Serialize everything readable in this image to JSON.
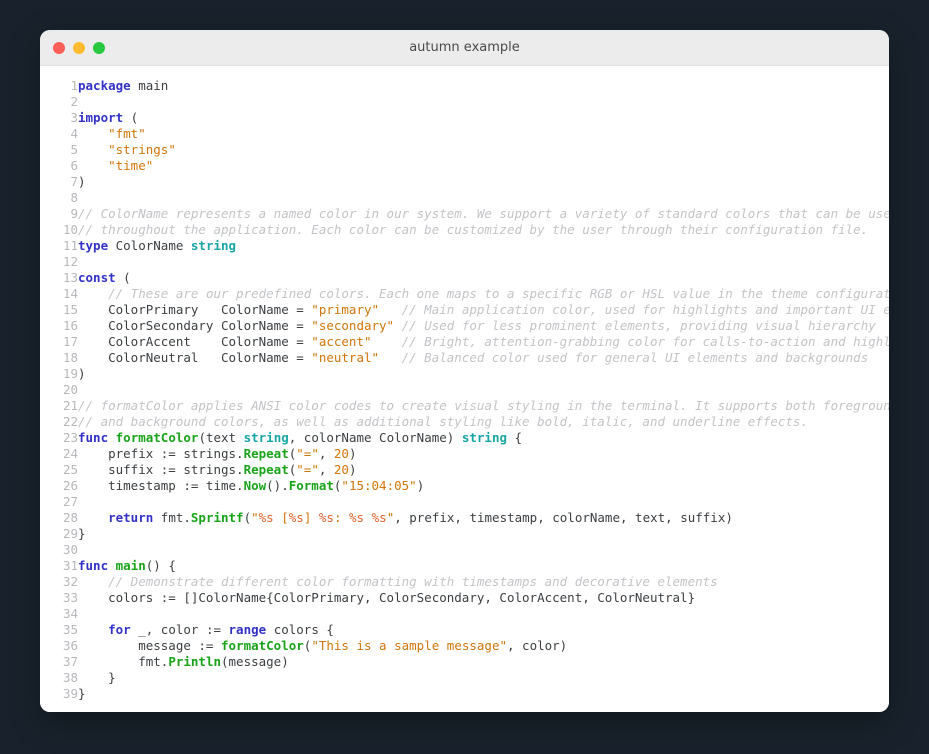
{
  "window": {
    "title": "autumn example",
    "traffic_lights": [
      {
        "name": "close-button",
        "color": "#ff5f57"
      },
      {
        "name": "minimize-button",
        "color": "#febc2e"
      },
      {
        "name": "maximize-button",
        "color": "#28c840"
      }
    ]
  },
  "theme": {
    "page_background": "#19222c",
    "window_background": "#ffffff",
    "titlebar_background": "#ececec",
    "keyword": "#3232c8",
    "type": "#1aa6a6",
    "string": "#d2760b",
    "format_verb": "#e2622b",
    "number": "#d2760b",
    "function": "#19a319",
    "comment": "#c2c4c7",
    "plain": "#3c4043",
    "line_number": "#b6b8bb"
  },
  "editor": {
    "language": "go",
    "first_line": 1,
    "last_line": 39,
    "lines": [
      {
        "n": 1,
        "tokens": [
          {
            "t": "kw",
            "v": "package"
          },
          {
            "t": "pl",
            "v": " main"
          }
        ]
      },
      {
        "n": 2,
        "tokens": []
      },
      {
        "n": 3,
        "tokens": [
          {
            "t": "kw",
            "v": "import"
          },
          {
            "t": "pl",
            "v": " ("
          }
        ]
      },
      {
        "n": 4,
        "tokens": [
          {
            "t": "pl",
            "v": "    "
          },
          {
            "t": "str",
            "v": "\"fmt\""
          }
        ]
      },
      {
        "n": 5,
        "tokens": [
          {
            "t": "pl",
            "v": "    "
          },
          {
            "t": "str",
            "v": "\"strings\""
          }
        ]
      },
      {
        "n": 6,
        "tokens": [
          {
            "t": "pl",
            "v": "    "
          },
          {
            "t": "str",
            "v": "\"time\""
          }
        ]
      },
      {
        "n": 7,
        "tokens": [
          {
            "t": "pl",
            "v": ")"
          }
        ]
      },
      {
        "n": 8,
        "tokens": []
      },
      {
        "n": 9,
        "tokens": [
          {
            "t": "cm",
            "v": "// ColorName represents a named color in our system. We support a variety of standard colors that can be used"
          }
        ]
      },
      {
        "n": 10,
        "tokens": [
          {
            "t": "cm",
            "v": "// throughout the application. Each color can be customized by the user through their configuration file."
          }
        ]
      },
      {
        "n": 11,
        "tokens": [
          {
            "t": "kw",
            "v": "type"
          },
          {
            "t": "pl",
            "v": " ColorName "
          },
          {
            "t": "typ",
            "v": "string"
          }
        ]
      },
      {
        "n": 12,
        "tokens": []
      },
      {
        "n": 13,
        "tokens": [
          {
            "t": "kw",
            "v": "const"
          },
          {
            "t": "pl",
            "v": " ("
          }
        ]
      },
      {
        "n": 14,
        "tokens": [
          {
            "t": "pl",
            "v": "    "
          },
          {
            "t": "cm",
            "v": "// These are our predefined colors. Each one maps to a specific RGB or HSL value in the theme configuration."
          }
        ]
      },
      {
        "n": 15,
        "tokens": [
          {
            "t": "pl",
            "v": "    ColorPrimary   ColorName = "
          },
          {
            "t": "str",
            "v": "\"primary\""
          },
          {
            "t": "pl",
            "v": "   "
          },
          {
            "t": "cm",
            "v": "// Main application color, used for highlights and important UI elements"
          }
        ]
      },
      {
        "n": 16,
        "tokens": [
          {
            "t": "pl",
            "v": "    ColorSecondary ColorName = "
          },
          {
            "t": "str",
            "v": "\"secondary\""
          },
          {
            "t": "pl",
            "v": " "
          },
          {
            "t": "cm",
            "v": "// Used for less prominent elements, providing visual hierarchy"
          }
        ]
      },
      {
        "n": 17,
        "tokens": [
          {
            "t": "pl",
            "v": "    ColorAccent    ColorName = "
          },
          {
            "t": "str",
            "v": "\"accent\""
          },
          {
            "t": "pl",
            "v": "    "
          },
          {
            "t": "cm",
            "v": "// Bright, attention-grabbing color for calls-to-action and highlights"
          }
        ]
      },
      {
        "n": 18,
        "tokens": [
          {
            "t": "pl",
            "v": "    ColorNeutral   ColorName = "
          },
          {
            "t": "str",
            "v": "\"neutral\""
          },
          {
            "t": "pl",
            "v": "   "
          },
          {
            "t": "cm",
            "v": "// Balanced color used for general UI elements and backgrounds"
          }
        ]
      },
      {
        "n": 19,
        "tokens": [
          {
            "t": "pl",
            "v": ")"
          }
        ]
      },
      {
        "n": 20,
        "tokens": []
      },
      {
        "n": 21,
        "tokens": [
          {
            "t": "cm",
            "v": "// formatColor applies ANSI color codes to create visual styling in the terminal. It supports both foreground"
          }
        ]
      },
      {
        "n": 22,
        "tokens": [
          {
            "t": "cm",
            "v": "// and background colors, as well as additional styling like bold, italic, and underline effects."
          }
        ]
      },
      {
        "n": 23,
        "tokens": [
          {
            "t": "kw",
            "v": "func"
          },
          {
            "t": "pl",
            "v": " "
          },
          {
            "t": "fn",
            "v": "formatColor"
          },
          {
            "t": "pl",
            "v": "(text "
          },
          {
            "t": "typ",
            "v": "string"
          },
          {
            "t": "pl",
            "v": ", colorName ColorName) "
          },
          {
            "t": "typ",
            "v": "string"
          },
          {
            "t": "pl",
            "v": " {"
          }
        ]
      },
      {
        "n": 24,
        "tokens": [
          {
            "t": "pl",
            "v": "    prefix := strings."
          },
          {
            "t": "fn",
            "v": "Repeat"
          },
          {
            "t": "pl",
            "v": "("
          },
          {
            "t": "str",
            "v": "\"=\""
          },
          {
            "t": "pl",
            "v": ", "
          },
          {
            "t": "num",
            "v": "20"
          },
          {
            "t": "pl",
            "v": ")"
          }
        ]
      },
      {
        "n": 25,
        "tokens": [
          {
            "t": "pl",
            "v": "    suffix := strings."
          },
          {
            "t": "fn",
            "v": "Repeat"
          },
          {
            "t": "pl",
            "v": "("
          },
          {
            "t": "str",
            "v": "\"=\""
          },
          {
            "t": "pl",
            "v": ", "
          },
          {
            "t": "num",
            "v": "20"
          },
          {
            "t": "pl",
            "v": ")"
          }
        ]
      },
      {
        "n": 26,
        "tokens": [
          {
            "t": "pl",
            "v": "    timestamp := time."
          },
          {
            "t": "fn",
            "v": "Now"
          },
          {
            "t": "pl",
            "v": "()."
          },
          {
            "t": "fn",
            "v": "Format"
          },
          {
            "t": "pl",
            "v": "("
          },
          {
            "t": "str",
            "v": "\"15:04:05\""
          },
          {
            "t": "pl",
            "v": ")"
          }
        ]
      },
      {
        "n": 27,
        "tokens": []
      },
      {
        "n": 28,
        "tokens": [
          {
            "t": "pl",
            "v": "    "
          },
          {
            "t": "kw",
            "v": "return"
          },
          {
            "t": "pl",
            "v": " fmt."
          },
          {
            "t": "fn",
            "v": "Sprintf"
          },
          {
            "t": "pl",
            "v": "("
          },
          {
            "t": "str",
            "v": "\""
          },
          {
            "t": "verb",
            "v": "%s"
          },
          {
            "t": "str",
            "v": " ["
          },
          {
            "t": "verb",
            "v": "%s"
          },
          {
            "t": "str",
            "v": "] "
          },
          {
            "t": "verb",
            "v": "%s"
          },
          {
            "t": "str",
            "v": ": "
          },
          {
            "t": "verb",
            "v": "%s"
          },
          {
            "t": "str",
            "v": " "
          },
          {
            "t": "verb",
            "v": "%s"
          },
          {
            "t": "str",
            "v": "\""
          },
          {
            "t": "pl",
            "v": ", prefix, timestamp, colorName, text, suffix)"
          }
        ]
      },
      {
        "n": 29,
        "tokens": [
          {
            "t": "pl",
            "v": "}"
          }
        ]
      },
      {
        "n": 30,
        "tokens": []
      },
      {
        "n": 31,
        "tokens": [
          {
            "t": "kw",
            "v": "func"
          },
          {
            "t": "pl",
            "v": " "
          },
          {
            "t": "fn",
            "v": "main"
          },
          {
            "t": "pl",
            "v": "() {"
          }
        ]
      },
      {
        "n": 32,
        "tokens": [
          {
            "t": "pl",
            "v": "    "
          },
          {
            "t": "cm",
            "v": "// Demonstrate different color formatting with timestamps and decorative elements"
          }
        ]
      },
      {
        "n": 33,
        "tokens": [
          {
            "t": "pl",
            "v": "    colors := []ColorName{ColorPrimary, ColorSecondary, ColorAccent, ColorNeutral}"
          }
        ]
      },
      {
        "n": 34,
        "tokens": []
      },
      {
        "n": 35,
        "tokens": [
          {
            "t": "pl",
            "v": "    "
          },
          {
            "t": "kw",
            "v": "for"
          },
          {
            "t": "pl",
            "v": " _, color := "
          },
          {
            "t": "kw",
            "v": "range"
          },
          {
            "t": "pl",
            "v": " colors {"
          }
        ]
      },
      {
        "n": 36,
        "tokens": [
          {
            "t": "pl",
            "v": "        message := "
          },
          {
            "t": "fn",
            "v": "formatColor"
          },
          {
            "t": "pl",
            "v": "("
          },
          {
            "t": "str",
            "v": "\"This is a sample message\""
          },
          {
            "t": "pl",
            "v": ", color)"
          }
        ]
      },
      {
        "n": 37,
        "tokens": [
          {
            "t": "pl",
            "v": "        fmt."
          },
          {
            "t": "fn",
            "v": "Println"
          },
          {
            "t": "pl",
            "v": "(message)"
          }
        ]
      },
      {
        "n": 38,
        "tokens": [
          {
            "t": "pl",
            "v": "    }"
          }
        ]
      },
      {
        "n": 39,
        "tokens": [
          {
            "t": "pl",
            "v": "}"
          }
        ]
      }
    ]
  }
}
